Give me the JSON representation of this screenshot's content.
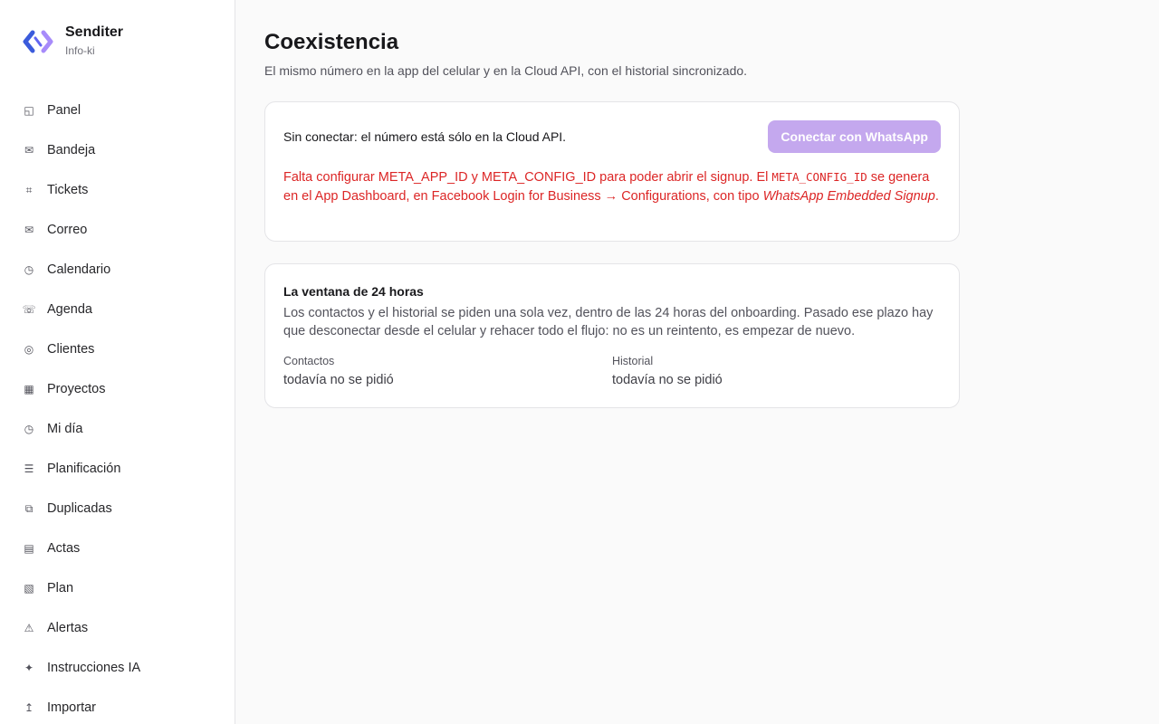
{
  "brand": {
    "name": "Senditer",
    "subtitle": "Info-ki"
  },
  "sidebar": {
    "items": [
      {
        "label": "Panel",
        "icon": "panel-icon",
        "glyph": "◱"
      },
      {
        "label": "Bandeja",
        "icon": "inbox-icon",
        "glyph": "✉"
      },
      {
        "label": "Tickets",
        "icon": "ticket-icon",
        "glyph": "⌗"
      },
      {
        "label": "Correo",
        "icon": "mail-icon",
        "glyph": "✉"
      },
      {
        "label": "Calendario",
        "icon": "calendar-icon",
        "glyph": "◷"
      },
      {
        "label": "Agenda",
        "icon": "phone-icon",
        "glyph": "☏"
      },
      {
        "label": "Clientes",
        "icon": "clients-icon",
        "glyph": "◎"
      },
      {
        "label": "Proyectos",
        "icon": "projects-icon",
        "glyph": "▦"
      },
      {
        "label": "Mi día",
        "icon": "clock-icon",
        "glyph": "◷"
      },
      {
        "label": "Planificación",
        "icon": "list-icon",
        "glyph": "☰"
      },
      {
        "label": "Duplicadas",
        "icon": "duplicate-icon",
        "glyph": "⧉"
      },
      {
        "label": "Actas",
        "icon": "document-icon",
        "glyph": "▤"
      },
      {
        "label": "Plan",
        "icon": "plan-icon",
        "glyph": "▧"
      },
      {
        "label": "Alertas",
        "icon": "alert-icon",
        "glyph": "⚠"
      },
      {
        "label": "Instrucciones IA",
        "icon": "sparkle-icon",
        "glyph": "✦"
      },
      {
        "label": "Importar",
        "icon": "import-icon",
        "glyph": "↥"
      }
    ]
  },
  "page": {
    "title": "Coexistencia",
    "subtitle": "El mismo número en la app del celular y en la Cloud API, con el historial sincronizado."
  },
  "connection": {
    "status": "Sin conectar: el número está sólo en la Cloud API.",
    "button_label": "Conectar con WhatsApp",
    "error_part1": "Falta configurar META_APP_ID y META_CONFIG_ID para poder abrir el signup. El ",
    "error_code": "META_CONFIG_ID",
    "error_part2": " se genera en el App Dashboard, en Facebook Login for Business → Configurations, con tipo ",
    "error_italic": "WhatsApp Embedded Signup",
    "error_part3": "."
  },
  "window_card": {
    "title": "La ventana de 24 horas",
    "body": "Los contactos y el historial se piden una sola vez, dentro de las 24 horas del onboarding. Pasado ese plazo hay que desconectar desde el celular y rehacer todo el flujo: no es un reintento, es empezar de nuevo.",
    "stats": [
      {
        "label": "Contactos",
        "value": "todavía no se pidió"
      },
      {
        "label": "Historial",
        "value": "todavía no se pidió"
      }
    ]
  },
  "colors": {
    "accent_disabled": "#c4a8ee",
    "error": "#dc2626",
    "logo_blue": "#3b5bdb",
    "logo_purple": "#a78bfa"
  }
}
